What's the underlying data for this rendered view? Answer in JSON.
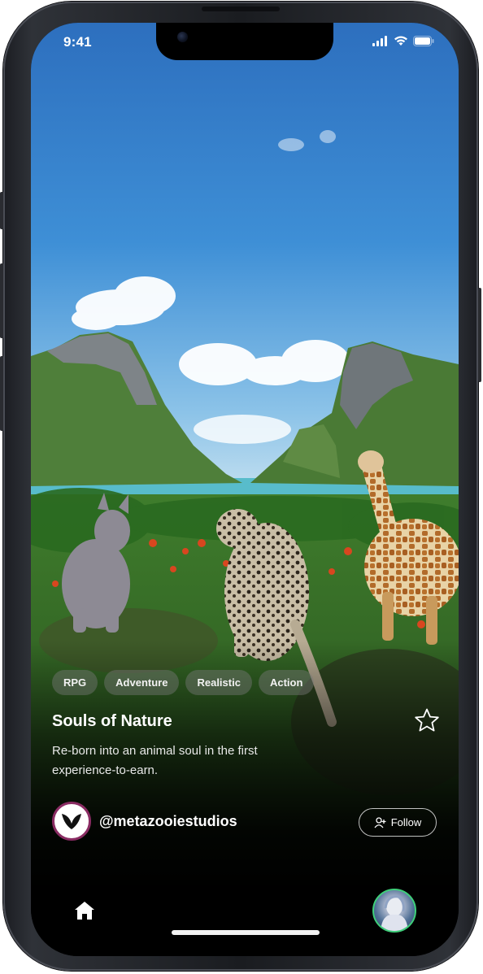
{
  "status_bar": {
    "time": "9:41"
  },
  "game": {
    "tags": [
      "RPG",
      "Adventure",
      "Realistic",
      "Action"
    ],
    "title": "Souls of Nature",
    "description": "Re-born into an animal soul in the first experience-to-earn."
  },
  "creator": {
    "handle": "@metazooiestudios",
    "follow_label": "Follow"
  },
  "nav": {
    "home_icon": "home-icon",
    "profile_icon": "profile-avatar"
  },
  "colors": {
    "follow_border": "#ffffff",
    "avatar_ring": "#8a2c63",
    "profile_ring": "#3fcf7a"
  }
}
